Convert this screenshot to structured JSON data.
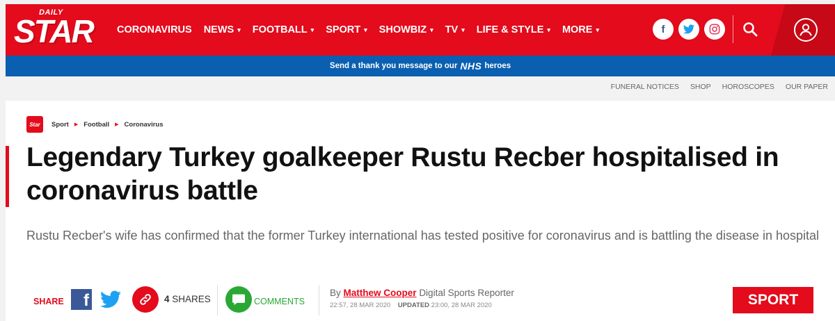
{
  "header": {
    "logo_top": "DAILY",
    "logo_main": "STAR",
    "nav": [
      {
        "label": "CORONAVIRUS",
        "dropdown": false
      },
      {
        "label": "NEWS",
        "dropdown": true
      },
      {
        "label": "FOOTBALL",
        "dropdown": true
      },
      {
        "label": "SPORT",
        "dropdown": true
      },
      {
        "label": "SHOWBIZ",
        "dropdown": true
      },
      {
        "label": "TV",
        "dropdown": true
      },
      {
        "label": "LIFE & STYLE",
        "dropdown": true
      },
      {
        "label": "MORE",
        "dropdown": true
      }
    ],
    "caret": "▾",
    "social_icons": [
      "facebook-icon",
      "twitter-icon",
      "instagram-icon"
    ],
    "social_glyphs": {
      "facebook": "f",
      "twitter": "t",
      "instagram": "◎"
    },
    "colors": {
      "brand_red": "#e30b1c",
      "nhs_blue": "#0b5fb0"
    }
  },
  "banner": {
    "text_before": "Send a thank you message to our",
    "nhs_logo": "NHS",
    "text_after": "heroes"
  },
  "utility_links": [
    "FUNERAL NOTICES",
    "SHOP",
    "HOROSCOPES",
    "OUR PAPER"
  ],
  "article": {
    "crumb_logo": "Star",
    "breadcrumbs": [
      "Sport",
      "Football",
      "Coronavirus"
    ],
    "crumb_sep": "▶",
    "headline": "Legendary Turkey goalkeeper Rustu Recber hospitalised in coronavirus battle",
    "standfirst": "Rustu Recber's wife has confirmed that the former Turkey international has tested positive for coronavirus and is battling the disease in hospital",
    "share": {
      "label": "SHARE",
      "fb_glyph": "f",
      "count": "4",
      "count_label": "SHARES",
      "comments_label": "COMMENTS"
    },
    "byline": {
      "prefix": "By",
      "author": "Matthew Cooper",
      "role": "Digital Sports Reporter",
      "published": "22:57, 28 MAR 2020",
      "updated_label": "UPDATED",
      "updated": "23:00, 28 MAR 2020"
    },
    "section": "SPORT"
  }
}
